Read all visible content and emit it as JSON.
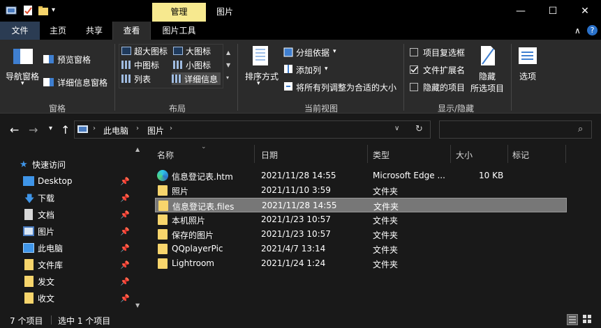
{
  "titlebar": {
    "context_tab": "管理",
    "title": "图片",
    "minimize": "—",
    "maximize": "☐",
    "close": "✕"
  },
  "tabs": [
    "文件",
    "主页",
    "共享",
    "查看",
    "图片工具"
  ],
  "ribbon": {
    "nav_pane": "导航窗格",
    "preview_pane": "预览窗格",
    "details_pane": "详细信息窗格",
    "group_panes": "窗格",
    "layout": {
      "extra_large": "超大图标",
      "large": "大图标",
      "medium": "中图标",
      "small": "小图标",
      "list": "列表",
      "details": "详细信息"
    },
    "group_layout": "布局",
    "sort": "排序方式",
    "group_by": "分组依据",
    "add_column": "添加列",
    "size_all_columns": "将所有列调整为合适的大小",
    "group_current_view": "当前视图",
    "item_checkboxes": "项目复选框",
    "file_extensions": "文件扩展名",
    "hidden_items": "隐藏的项目",
    "hide": "隐藏",
    "hide_selected": "所选项目",
    "group_show_hide": "显示/隐藏",
    "options": "选项",
    "file_extensions_checked": true
  },
  "address": {
    "segments": [
      "此电脑",
      "图片"
    ]
  },
  "sidebar": {
    "quick_access": "快速访问",
    "items": [
      "Desktop",
      "下载",
      "文档",
      "图片",
      "此电脑",
      "文件库",
      "发文",
      "收文"
    ]
  },
  "columns": [
    "名称",
    "日期",
    "类型",
    "大小",
    "标记"
  ],
  "files": [
    {
      "name": "信息登记表.htm",
      "date": "2021/11/28 14:55",
      "type": "Microsoft Edge ...",
      "size": "10 KB",
      "icon": "edge-icon"
    },
    {
      "name": "照片",
      "date": "2021/11/10 3:59",
      "type": "文件夹",
      "size": "",
      "icon": "folder-icon"
    },
    {
      "name": "信息登记表.files",
      "date": "2021/11/28 14:55",
      "type": "文件夹",
      "size": "",
      "icon": "folder-icon"
    },
    {
      "name": "本机照片",
      "date": "2021/1/23 10:57",
      "type": "文件夹",
      "size": "",
      "icon": "folder-icon"
    },
    {
      "name": "保存的图片",
      "date": "2021/1/23 10:57",
      "type": "文件夹",
      "size": "",
      "icon": "folder-icon"
    },
    {
      "name": "QQplayerPic",
      "date": "2021/4/7 13:14",
      "type": "文件夹",
      "size": "",
      "icon": "folder-icon"
    },
    {
      "name": "Lightroom",
      "date": "2021/1/24 1:24",
      "type": "文件夹",
      "size": "",
      "icon": "folder-icon"
    }
  ],
  "status": {
    "item_count": "7 个项目",
    "selected": "选中 1 个项目"
  },
  "colors": {
    "accent_folder": "#f7d56c",
    "context_tab": "#f7e98f",
    "selection": "#777777"
  }
}
